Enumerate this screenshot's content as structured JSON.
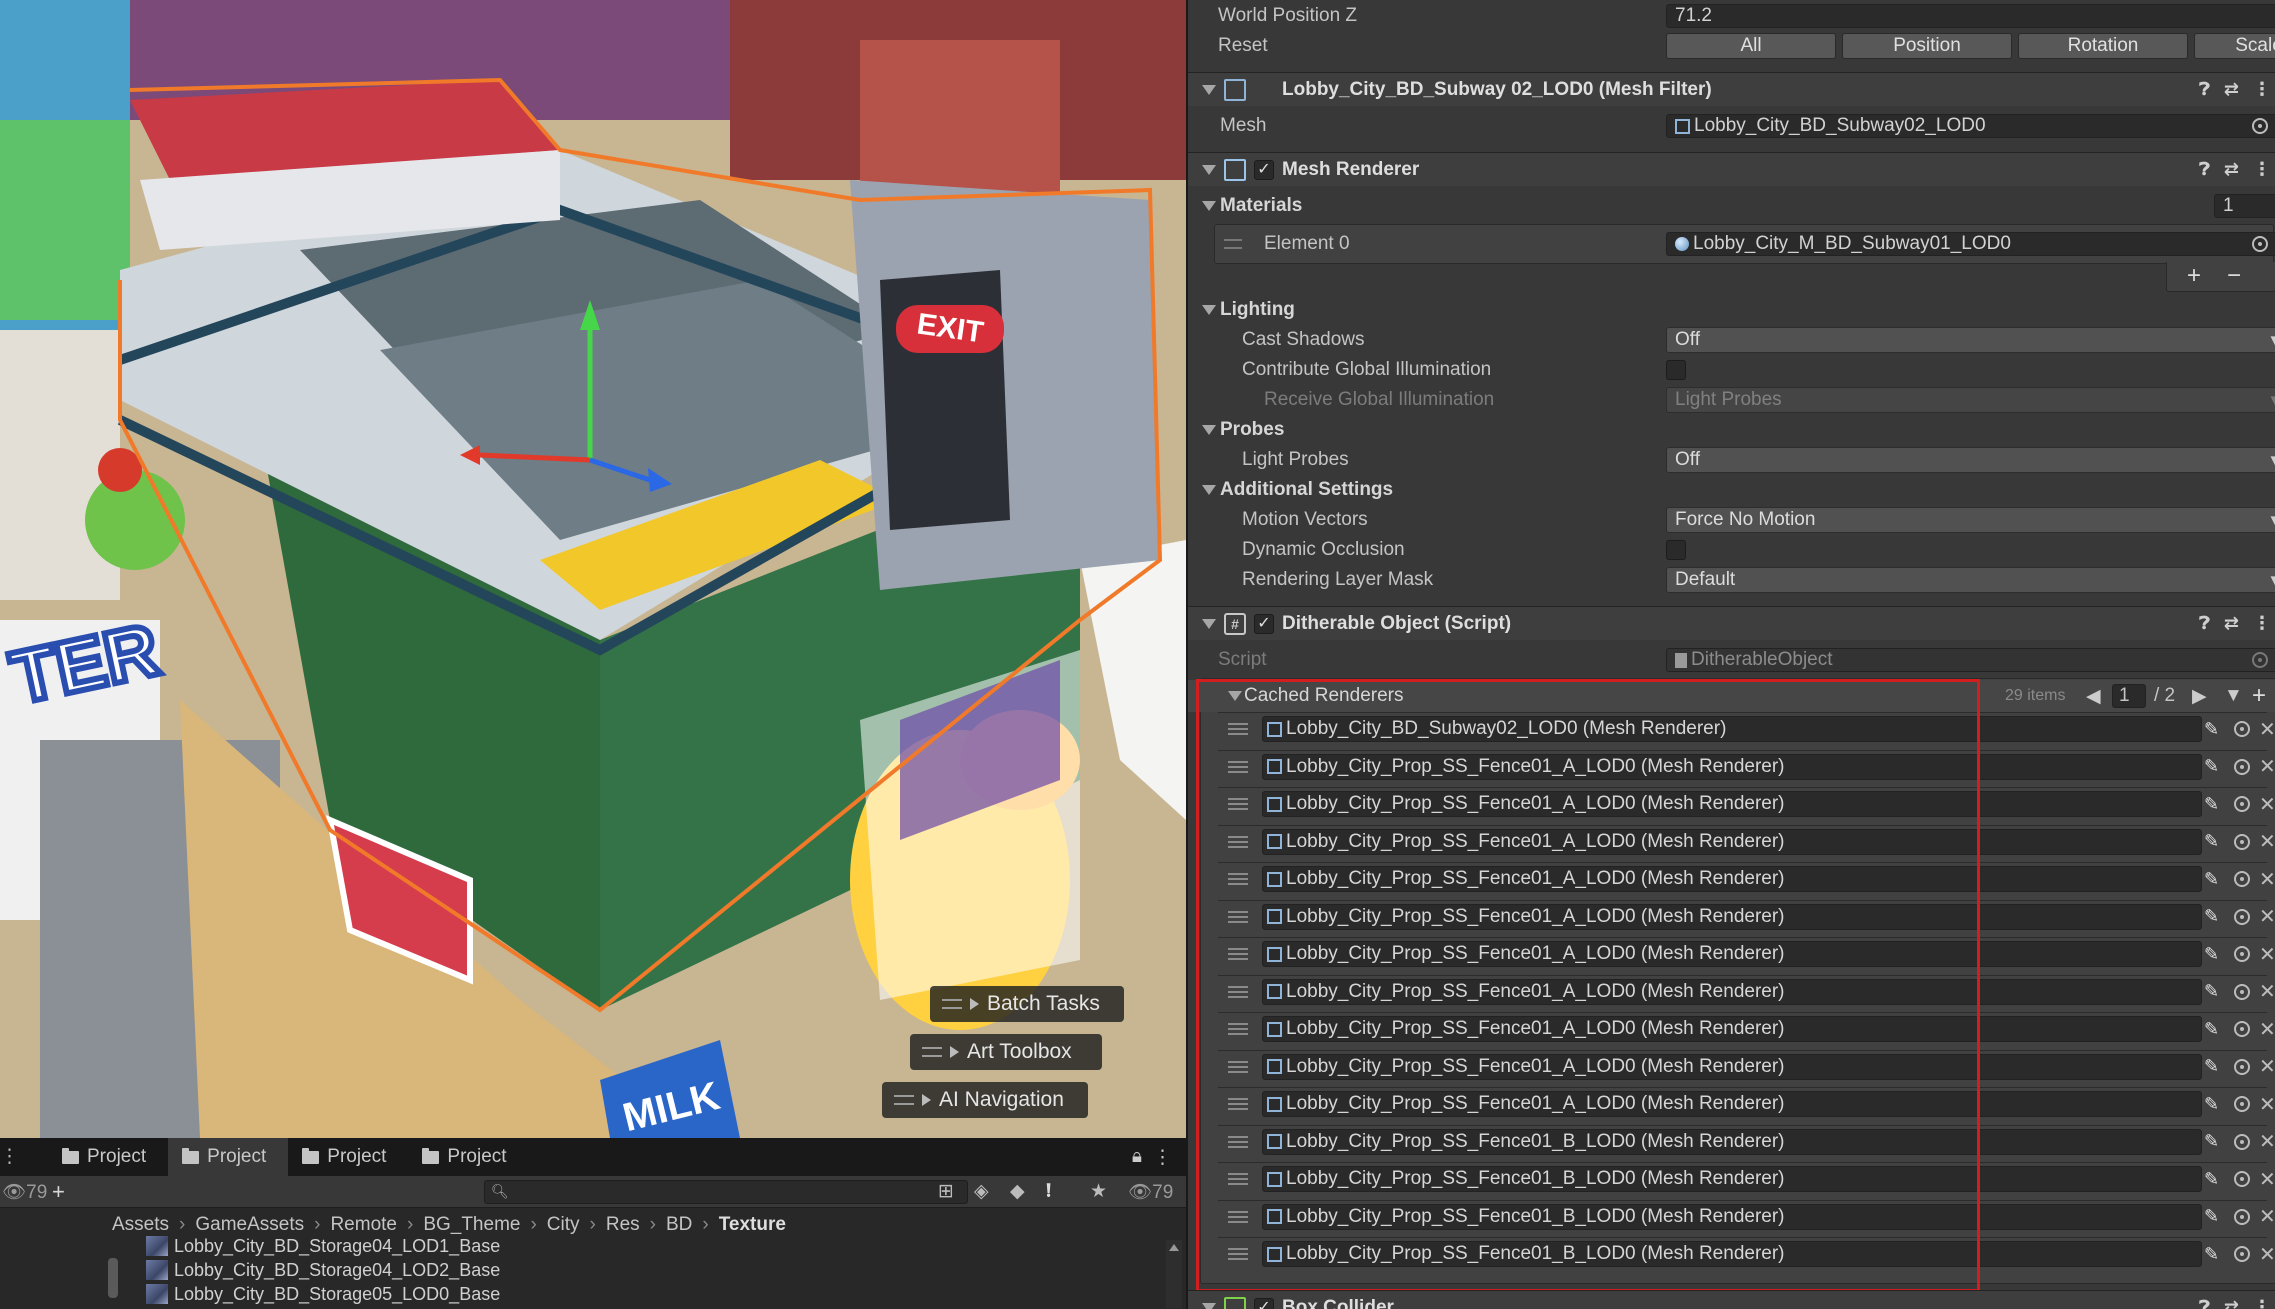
{
  "scene": {
    "overlays": [
      {
        "label": "Batch Tasks"
      },
      {
        "label": "Art Toolbox"
      },
      {
        "label": "AI Navigation"
      }
    ]
  },
  "project": {
    "tabs": [
      "Project",
      "Project",
      "Project",
      "Project"
    ],
    "count_left": "79",
    "count_right": "79",
    "breadcrumb": [
      "Assets",
      "GameAssets",
      "Remote",
      "BG_Theme",
      "City",
      "Res",
      "BD",
      "Texture"
    ],
    "files": [
      "Lobby_City_BD_Storage04_LOD1_Base",
      "Lobby_City_BD_Storage04_LOD2_Base",
      "Lobby_City_BD_Storage05_LOD0_Base"
    ]
  },
  "inspector": {
    "world_pos_z": {
      "label": "World Position Z",
      "value": "71.2"
    },
    "reset": {
      "label": "Reset",
      "buttons": [
        "All",
        "Position",
        "Rotation",
        "Scale"
      ]
    },
    "mesh_filter": {
      "title": "Lobby_City_BD_Subway 02_LOD0 (Mesh Filter)",
      "mesh_label": "Mesh",
      "mesh_value": "Lobby_City_BD_Subway02_LOD0"
    },
    "mesh_renderer": {
      "title": "Mesh Renderer",
      "materials_label": "Materials",
      "materials_count": "1",
      "element0_label": "Element 0",
      "element0_value": "Lobby_City_M_BD_Subway01_LOD0",
      "lighting": "Lighting",
      "cast_shadows": {
        "label": "Cast Shadows",
        "value": "Off"
      },
      "contribute_gi": {
        "label": "Contribute Global Illumination"
      },
      "receive_gi": {
        "label": "Receive Global Illumination",
        "value": "Light Probes"
      },
      "probes": "Probes",
      "light_probes": {
        "label": "Light Probes",
        "value": "Off"
      },
      "additional": "Additional Settings",
      "motion_vectors": {
        "label": "Motion Vectors",
        "value": "Force No Motion"
      },
      "dynamic_occlusion": {
        "label": "Dynamic Occlusion"
      },
      "rendering_layer_mask": {
        "label": "Rendering Layer Mask",
        "value": "Default"
      }
    },
    "ditherable": {
      "title": "Ditherable Object (Script)",
      "script_label": "Script",
      "script_value": "DitherableObject",
      "cached_label": "Cached Renderers",
      "items_count": "29 items",
      "page": "1",
      "page_total": "/ 2",
      "renderers": [
        "Lobby_City_BD_Subway02_LOD0 (Mesh Renderer)",
        "Lobby_City_Prop_SS_Fence01_A_LOD0 (Mesh Renderer)",
        "Lobby_City_Prop_SS_Fence01_A_LOD0 (Mesh Renderer)",
        "Lobby_City_Prop_SS_Fence01_A_LOD0 (Mesh Renderer)",
        "Lobby_City_Prop_SS_Fence01_A_LOD0 (Mesh Renderer)",
        "Lobby_City_Prop_SS_Fence01_A_LOD0 (Mesh Renderer)",
        "Lobby_City_Prop_SS_Fence01_A_LOD0 (Mesh Renderer)",
        "Lobby_City_Prop_SS_Fence01_A_LOD0 (Mesh Renderer)",
        "Lobby_City_Prop_SS_Fence01_A_LOD0 (Mesh Renderer)",
        "Lobby_City_Prop_SS_Fence01_A_LOD0 (Mesh Renderer)",
        "Lobby_City_Prop_SS_Fence01_A_LOD0 (Mesh Renderer)",
        "Lobby_City_Prop_SS_Fence01_B_LOD0 (Mesh Renderer)",
        "Lobby_City_Prop_SS_Fence01_B_LOD0 (Mesh Renderer)",
        "Lobby_City_Prop_SS_Fence01_B_LOD0 (Mesh Renderer)",
        "Lobby_City_Prop_SS_Fence01_B_LOD0 (Mesh Renderer)"
      ]
    },
    "box_collider": {
      "title": "Box Collider"
    }
  },
  "colors": {
    "selection_outline": "#f07a2a",
    "highlight_box": "#d11f1f"
  }
}
